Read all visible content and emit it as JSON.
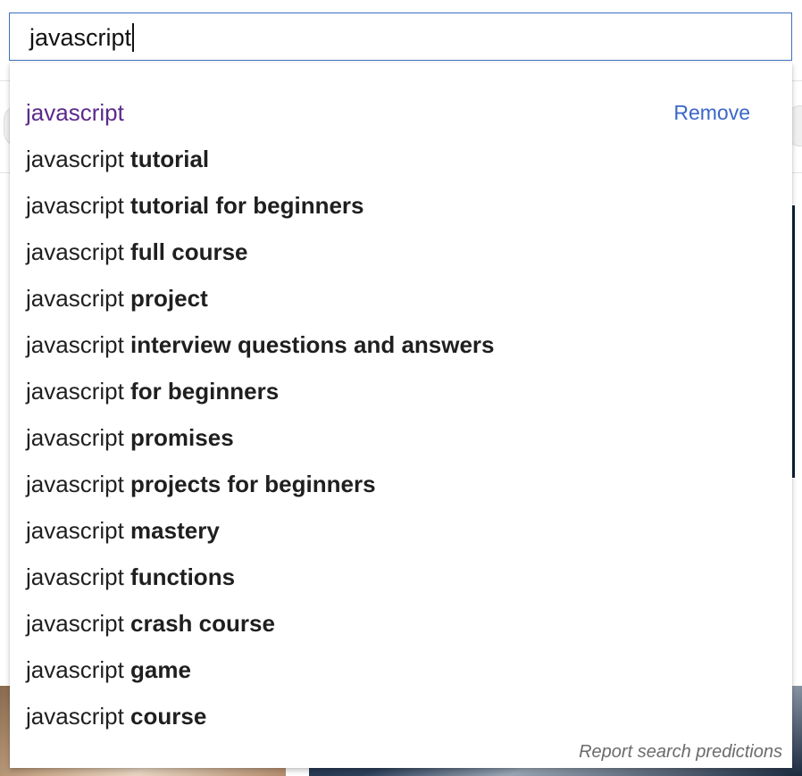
{
  "search": {
    "value": "javascript"
  },
  "suggestions": [
    {
      "query": "javascript",
      "completion": "",
      "history": true,
      "remove_label": "Remove"
    },
    {
      "query": "javascript ",
      "completion": "tutorial"
    },
    {
      "query": "javascript ",
      "completion": "tutorial for beginners"
    },
    {
      "query": "javascript ",
      "completion": "full course"
    },
    {
      "query": "javascript ",
      "completion": "project"
    },
    {
      "query": "javascript ",
      "completion": "interview questions and answers"
    },
    {
      "query": "javascript ",
      "completion": "for beginners"
    },
    {
      "query": "javascript ",
      "completion": "promises"
    },
    {
      "query": "javascript ",
      "completion": "projects for beginners"
    },
    {
      "query": "javascript ",
      "completion": "mastery"
    },
    {
      "query": "javascript ",
      "completion": "functions"
    },
    {
      "query": "javascript ",
      "completion": "crash course"
    },
    {
      "query": "javascript ",
      "completion": "game"
    },
    {
      "query": "javascript ",
      "completion": "course"
    }
  ],
  "report_label": "Report search predictions",
  "colors": {
    "history_text": "#5b2a8c",
    "remove_link": "#3b67c9",
    "input_border": "#3b6fc2"
  }
}
